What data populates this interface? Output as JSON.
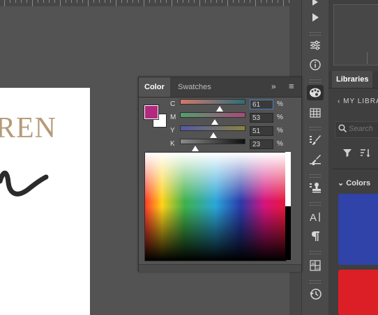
{
  "canvas": {
    "artboard_text": "REN"
  },
  "color_panel": {
    "tabs": [
      {
        "label": "Color"
      },
      {
        "label": "Swatches"
      }
    ],
    "collapse_glyph": "»",
    "menu_glyph": "≡",
    "fill_color": "#b3297f",
    "stroke_color": "#ffffff",
    "channels": [
      {
        "label": "C",
        "value": "61",
        "unit": "%",
        "fraction": 0.61
      },
      {
        "label": "M",
        "value": "53",
        "unit": "%",
        "fraction": 0.53
      },
      {
        "label": "Y",
        "value": "51",
        "unit": "%",
        "fraction": 0.51
      },
      {
        "label": "K",
        "value": "23",
        "unit": "%",
        "fraction": 0.23
      }
    ]
  },
  "tools": [
    {
      "icon": "play-icon"
    },
    {
      "icon": "adjustments-icon"
    },
    {
      "icon": "info-icon"
    },
    {
      "icon": "color-palette-icon"
    },
    {
      "icon": "grid-icon"
    },
    {
      "icon": "brush-presets-icon"
    },
    {
      "icon": "brush-settings-icon"
    },
    {
      "icon": "clone-stamp-icon"
    },
    {
      "icon": "character-icon"
    },
    {
      "icon": "paragraph-icon"
    },
    {
      "icon": "glyphs-icon"
    },
    {
      "icon": "history-icon"
    }
  ],
  "libraries": {
    "tab_label": "Libraries",
    "back_label": "MY LIBRA",
    "search_placeholder": "Search",
    "section_label": "Colors",
    "swatches": [
      "#2f43a8",
      "#dc1f26"
    ]
  }
}
